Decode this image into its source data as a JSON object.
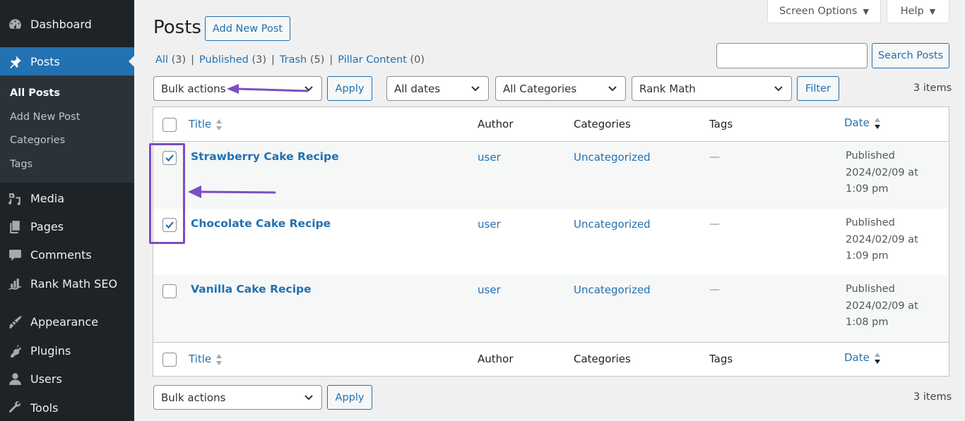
{
  "sidebar": {
    "items": [
      {
        "label": "Dashboard",
        "icon": "dashboard-icon"
      },
      {
        "label": "Posts",
        "icon": "pin-icon",
        "active": true
      },
      {
        "label": "Media",
        "icon": "media-icon"
      },
      {
        "label": "Pages",
        "icon": "pages-icon"
      },
      {
        "label": "Comments",
        "icon": "comment-icon"
      },
      {
        "label": "Rank Math SEO",
        "icon": "rank-math-icon"
      },
      {
        "label": "Appearance",
        "icon": "paintbrush-icon"
      },
      {
        "label": "Plugins",
        "icon": "plugin-icon"
      },
      {
        "label": "Users",
        "icon": "user-icon"
      },
      {
        "label": "Tools",
        "icon": "wrench-icon"
      }
    ],
    "submenu": [
      {
        "label": "All Posts",
        "current": true
      },
      {
        "label": "Add New Post"
      },
      {
        "label": "Categories"
      },
      {
        "label": "Tags"
      }
    ]
  },
  "header": {
    "screen_options": "Screen Options",
    "help": "Help",
    "title": "Posts",
    "add_new": "Add New Post"
  },
  "views": [
    {
      "label": "All",
      "count": "(3)"
    },
    {
      "label": "Published",
      "count": "(3)"
    },
    {
      "label": "Trash",
      "count": "(5)"
    },
    {
      "label": "Pillar Content",
      "count": "(0)"
    }
  ],
  "view_separator": "|",
  "search": {
    "value": "",
    "button": "Search Posts"
  },
  "filters": {
    "bulk_actions": "Bulk actions",
    "apply": "Apply",
    "dates": "All dates",
    "categories": "All Categories",
    "rank_math": "Rank Math",
    "filter": "Filter",
    "items_count": "3 items"
  },
  "table": {
    "columns": {
      "title": "Title",
      "author": "Author",
      "categories": "Categories",
      "tags": "Tags",
      "date": "Date"
    },
    "rows": [
      {
        "title": "Strawberry Cake Recipe",
        "author": "user",
        "category": "Uncategorized",
        "tags": "—",
        "status": "Published",
        "date": "2024/02/09 at 1:09 pm",
        "checked": true
      },
      {
        "title": "Chocolate Cake Recipe",
        "author": "user",
        "category": "Uncategorized",
        "tags": "—",
        "status": "Published",
        "date": "2024/02/09 at 1:09 pm",
        "checked": true
      },
      {
        "title": "Vanilla Cake Recipe",
        "author": "user",
        "category": "Uncategorized",
        "tags": "—",
        "status": "Published",
        "date": "2024/02/09 at 1:08 pm",
        "checked": false
      }
    ]
  },
  "bottom": {
    "bulk_actions": "Bulk actions",
    "apply": "Apply",
    "items_count": "3 items"
  },
  "colors": {
    "accent": "#2271b1",
    "sidebar_bg": "#1d2327",
    "annotation": "#7b4ec2"
  }
}
